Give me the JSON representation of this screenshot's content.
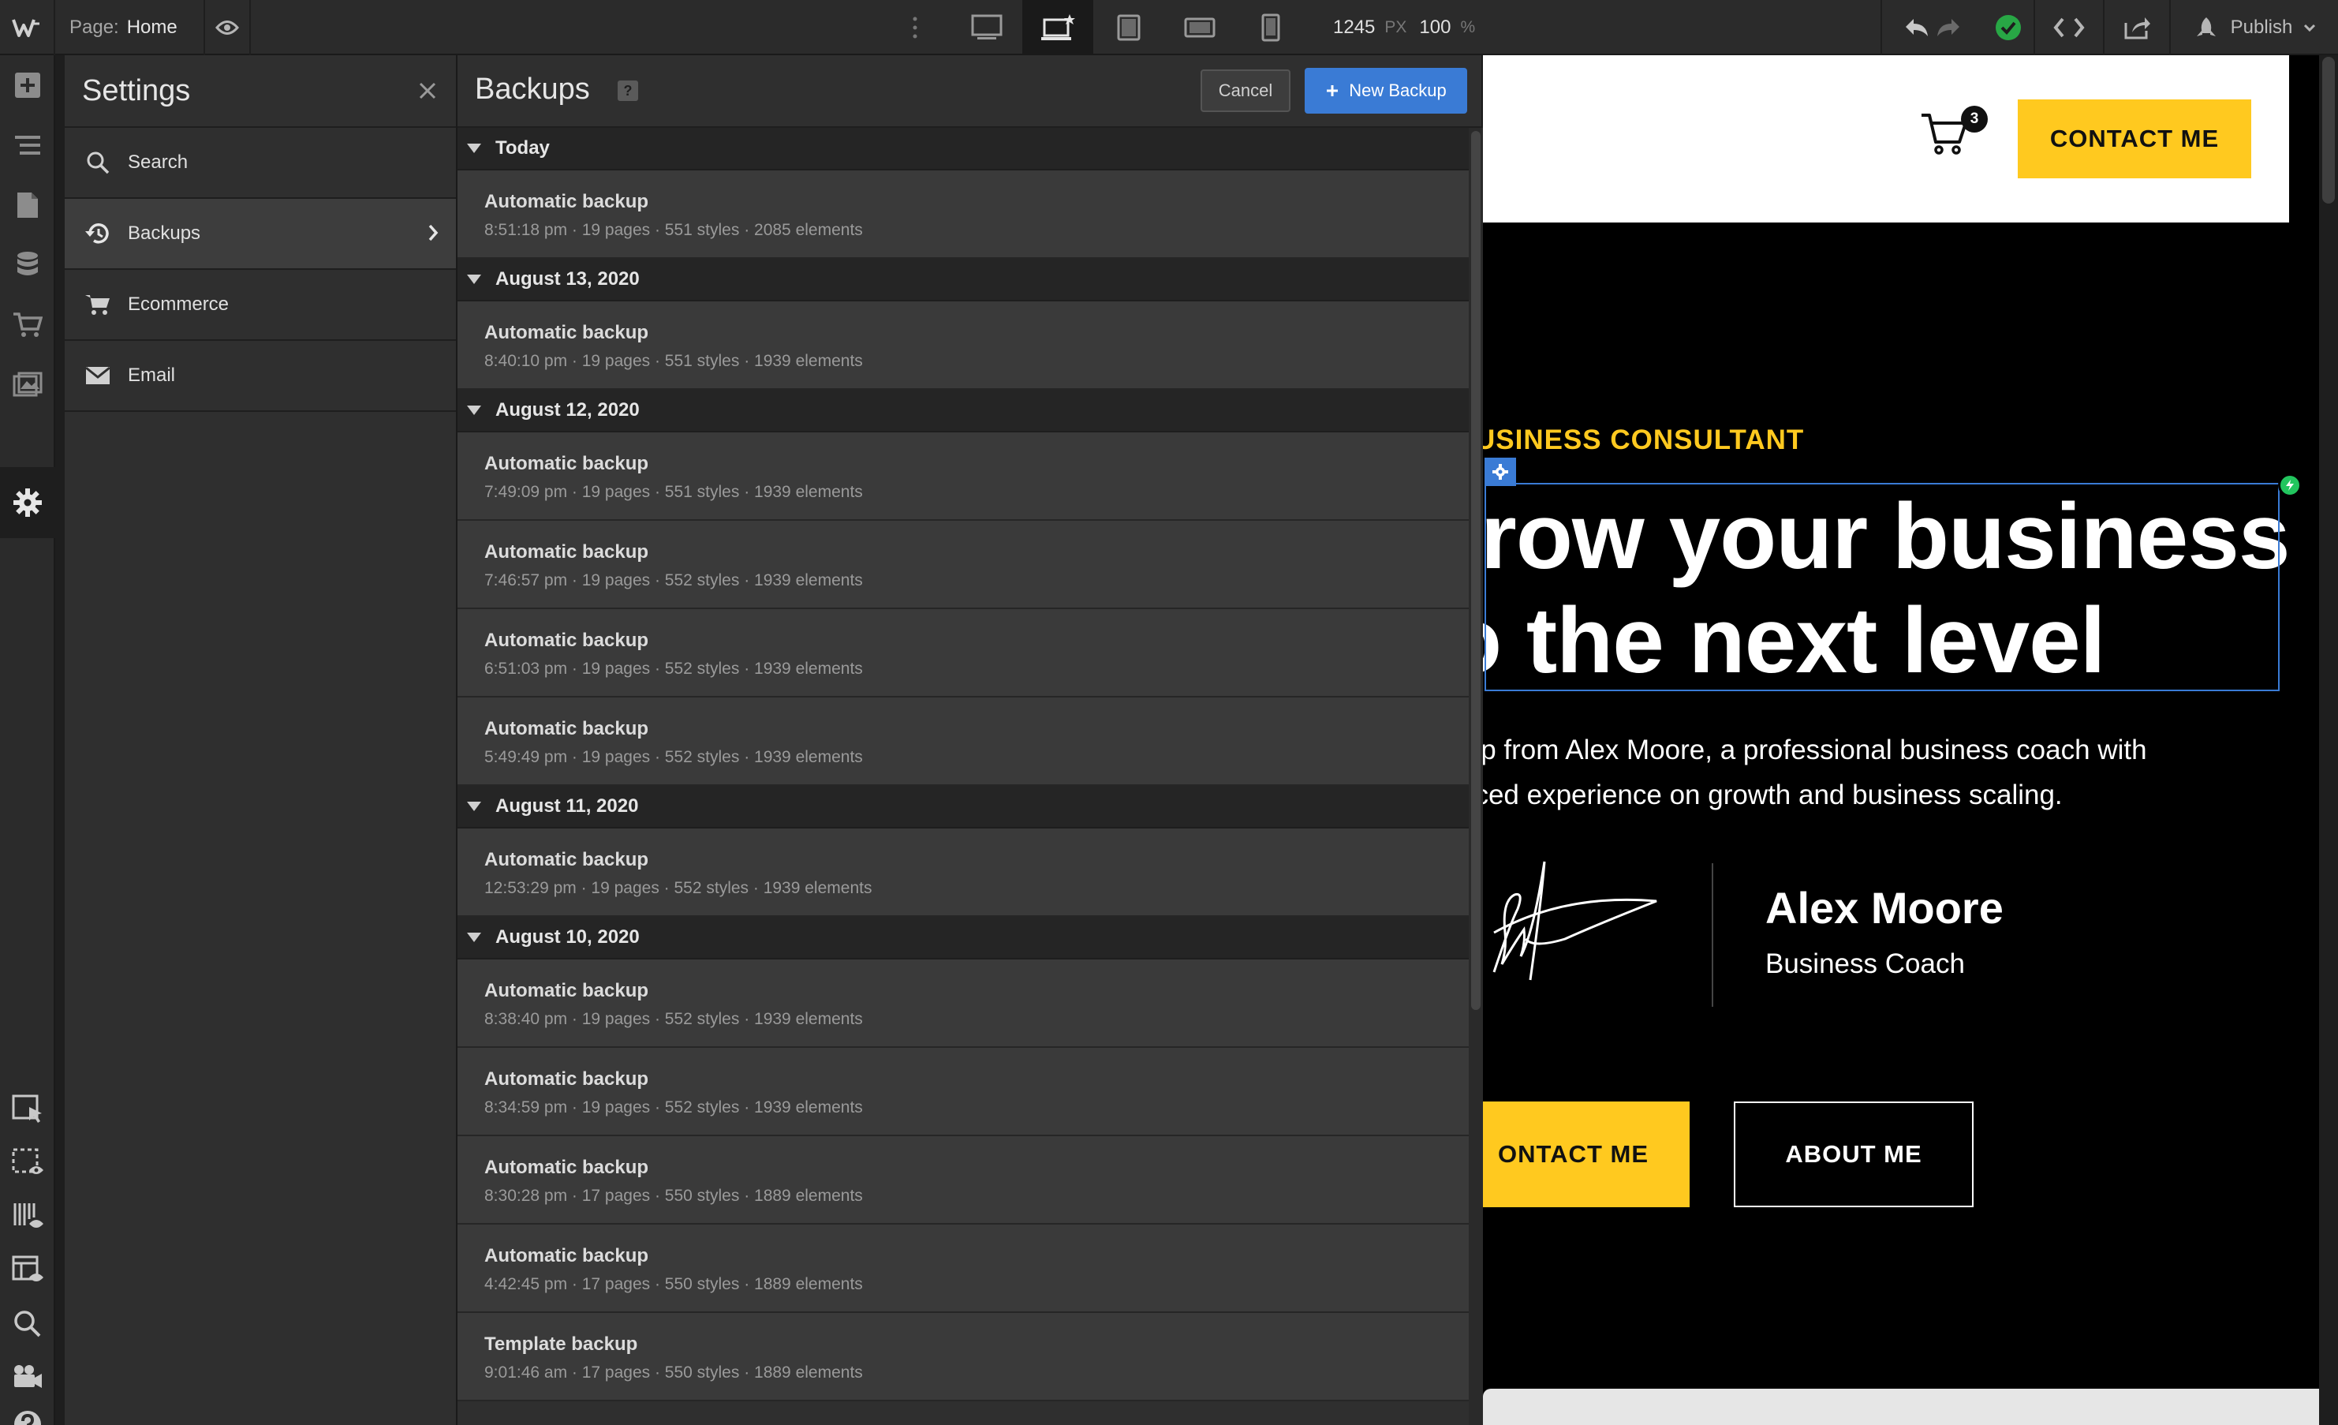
{
  "topbar": {
    "page_label": "Page:",
    "page_name": "Home",
    "width_value": "1245",
    "width_unit": "PX",
    "zoom_value": "100",
    "zoom_unit": "%",
    "publish_label": "Publish",
    "devices": [
      "desktop",
      "laptop",
      "tablet",
      "mobile-landscape",
      "mobile-portrait"
    ],
    "status_color": "#28a745"
  },
  "settings": {
    "title": "Settings",
    "items": [
      {
        "label": "Search",
        "icon": "search-icon"
      },
      {
        "label": "Backups",
        "icon": "history-icon",
        "active": true
      },
      {
        "label": "Ecommerce",
        "icon": "cart-icon"
      },
      {
        "label": "Email",
        "icon": "envelope-icon"
      }
    ]
  },
  "backups": {
    "title": "Backups",
    "help": "?",
    "cancel_label": "Cancel",
    "new_label": "New Backup",
    "groups": [
      {
        "date": "Today",
        "items": [
          {
            "name": "Automatic backup",
            "meta": "8:51:18 pm · 19 pages · 551 styles · 2085 elements"
          }
        ]
      },
      {
        "date": "August 13, 2020",
        "items": [
          {
            "name": "Automatic backup",
            "meta": "8:40:10 pm · 19 pages · 551 styles · 1939 elements"
          }
        ]
      },
      {
        "date": "August 12, 2020",
        "items": [
          {
            "name": "Automatic backup",
            "meta": "7:49:09 pm · 19 pages · 551 styles · 1939 elements"
          },
          {
            "name": "Automatic backup",
            "meta": "7:46:57 pm · 19 pages · 552 styles · 1939 elements"
          },
          {
            "name": "Automatic backup",
            "meta": "6:51:03 pm · 19 pages · 552 styles · 1939 elements"
          },
          {
            "name": "Automatic backup",
            "meta": "5:49:49 pm · 19 pages · 552 styles · 1939 elements"
          }
        ]
      },
      {
        "date": "August 11, 2020",
        "items": [
          {
            "name": "Automatic backup",
            "meta": "12:53:29 pm · 19 pages · 552 styles · 1939 elements"
          }
        ]
      },
      {
        "date": "August 10, 2020",
        "items": [
          {
            "name": "Automatic backup",
            "meta": "8:38:40 pm · 19 pages · 552 styles · 1939 elements"
          },
          {
            "name": "Automatic backup",
            "meta": "8:34:59 pm · 19 pages · 552 styles · 1939 elements"
          },
          {
            "name": "Automatic backup",
            "meta": "8:30:28 pm · 17 pages · 550 styles · 1889 elements"
          },
          {
            "name": "Automatic backup",
            "meta": "4:42:45 pm · 17 pages · 550 styles · 1889 elements"
          },
          {
            "name": "Template backup",
            "meta": "9:01:46 am · 17 pages · 550 styles · 1889 elements"
          }
        ]
      }
    ]
  },
  "canvas": {
    "cart_count": "3",
    "contact_top": "CONTACT ME",
    "eyebrow": "USINESS CONSULTANT",
    "headline_line1": "rrow your business",
    "headline_line2": "o the next level",
    "paragraph_line1": "elp from Alex Moore, a professional business coach with",
    "paragraph_line2": "nced experience on growth and business scaling.",
    "person_name": "Alex Moore",
    "person_role": "Business Coach",
    "contact_btn": "ONTACT ME",
    "about_btn": "ABOUT ME",
    "accent_color": "#ffc91f",
    "selection_color": "#3a7bd5"
  }
}
